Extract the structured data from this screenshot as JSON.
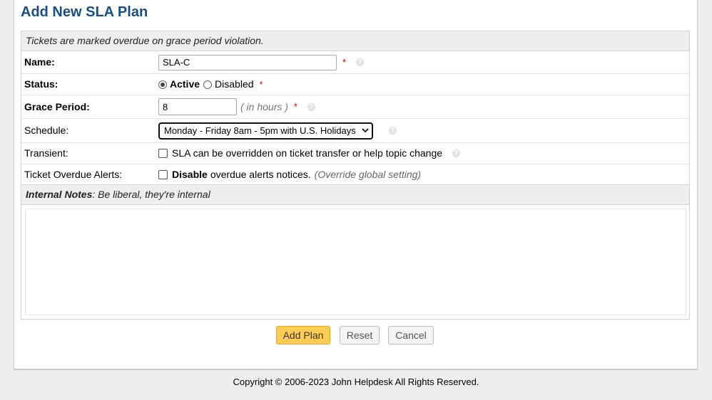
{
  "page": {
    "title": "Add New SLA Plan"
  },
  "form": {
    "header_note": "Tickets are marked overdue on grace period violation.",
    "name": {
      "label": "Name:",
      "value": "SLA-C",
      "required": "*"
    },
    "status": {
      "label": "Status:",
      "active_label": "Active",
      "disabled_label": "Disabled",
      "selected": "Active",
      "required": "*"
    },
    "grace": {
      "label": "Grace Period:",
      "value": "8",
      "unit": "( in hours )",
      "required": "*"
    },
    "schedule": {
      "label": "Schedule:",
      "selected": "Monday - Friday 8am - 5pm with U.S. Holidays"
    },
    "transient": {
      "label": "Transient:",
      "checkbox_label": "SLA can be overridden on ticket transfer or help topic change",
      "checked": false
    },
    "alerts": {
      "label": "Ticket Overdue Alerts:",
      "bold": "Disable",
      "text": "overdue alerts notices.",
      "note": "(Override global setting)",
      "checked": false
    },
    "notes": {
      "title": "Internal Notes",
      "subtitle": ": Be liberal, they're internal",
      "value": ""
    }
  },
  "buttons": {
    "add": "Add Plan",
    "reset": "Reset",
    "cancel": "Cancel"
  },
  "footer": {
    "text": "Copyright © 2006-2023 John Helpdesk All Rights Reserved."
  },
  "icons": {
    "help": "help-icon",
    "chevron": "chevron-down-icon"
  },
  "colors": {
    "title": "#184E81",
    "primary_button": "#ffcc55",
    "required": "#dd0000"
  }
}
